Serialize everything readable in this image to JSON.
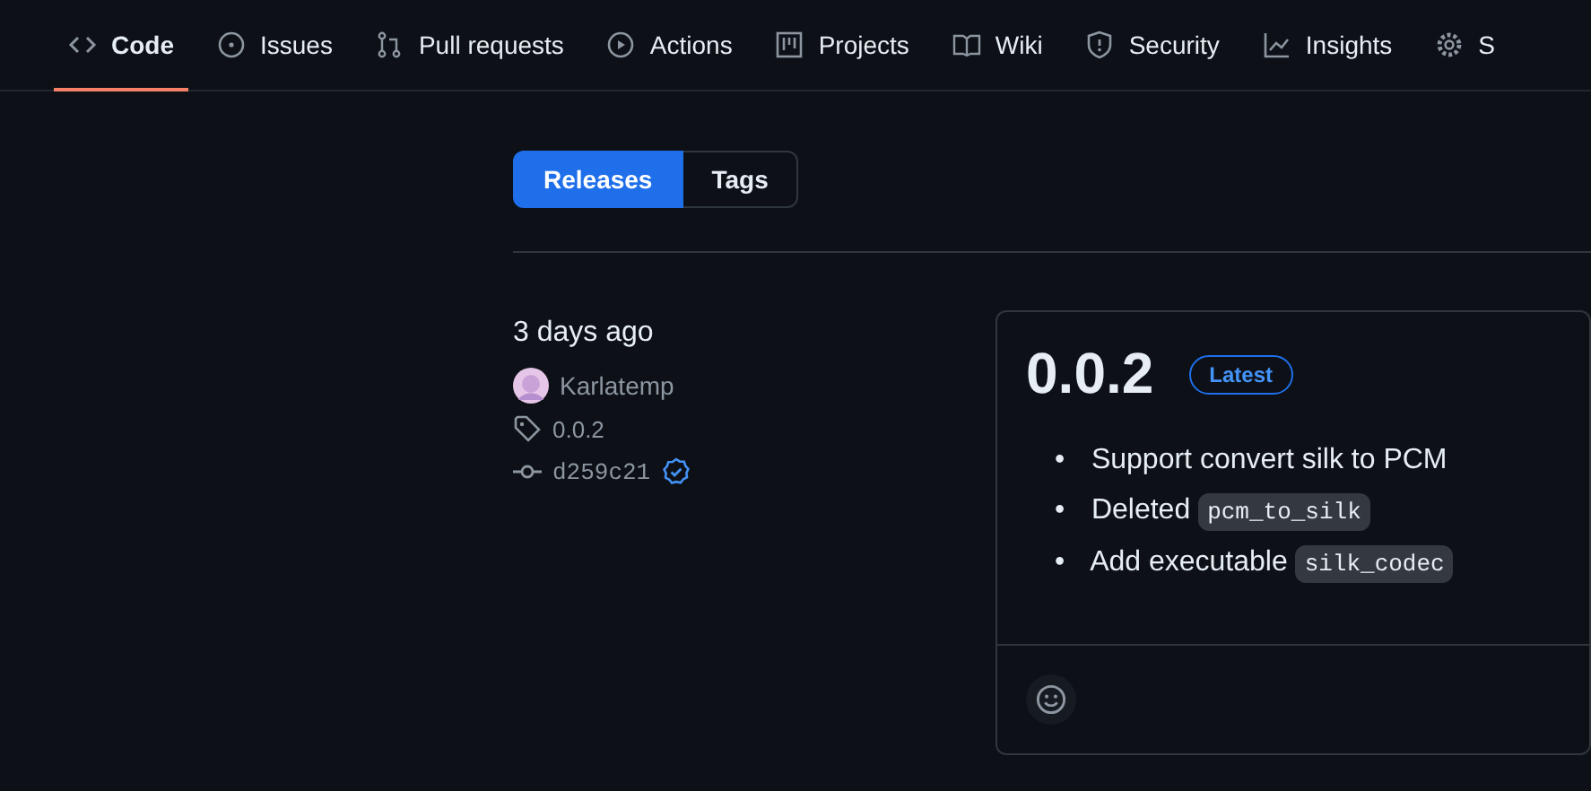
{
  "tabs": [
    {
      "label": "Code",
      "selected": true
    },
    {
      "label": "Issues",
      "selected": false
    },
    {
      "label": "Pull requests",
      "selected": false
    },
    {
      "label": "Actions",
      "selected": false
    },
    {
      "label": "Projects",
      "selected": false
    },
    {
      "label": "Wiki",
      "selected": false
    },
    {
      "label": "Security",
      "selected": false
    },
    {
      "label": "Insights",
      "selected": false
    },
    {
      "label": "S",
      "selected": false
    }
  ],
  "toggle": [
    {
      "label": "Releases",
      "selected": true
    },
    {
      "label": "Tags",
      "selected": false
    }
  ],
  "release": {
    "date": "3 days ago",
    "author": "Karlatemp",
    "tag": "0.0.2",
    "commit": "d259c21",
    "verified": true,
    "title": "0.0.2",
    "badge": "Latest",
    "notes": [
      {
        "marker": "•",
        "text": "Support convert silk to PCM"
      },
      {
        "marker": "•",
        "text": "Deleted",
        "code": "pcm_to_silk"
      },
      {
        "marker": "•",
        "text": "Add executable",
        "code": "silk_codec"
      }
    ]
  }
}
